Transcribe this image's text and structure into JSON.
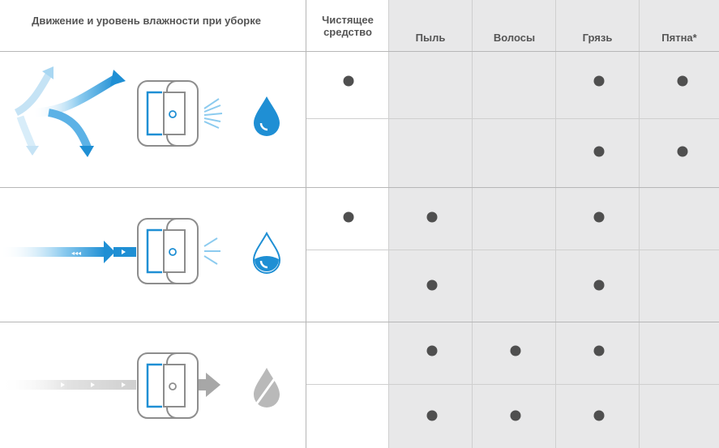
{
  "header": {
    "mode_title": "Движение и уровень влажности при уборке",
    "columns": [
      "Чистящее средство",
      "Пыль",
      "Волосы",
      "Грязь",
      "Пятна*"
    ]
  },
  "rows": [
    {
      "mode": "wet-cleaning",
      "moisture": "high",
      "options": [
        {
          "cells": [
            true,
            false,
            false,
            true,
            true
          ]
        },
        {
          "cells": [
            false,
            false,
            false,
            true,
            true
          ]
        }
      ]
    },
    {
      "mode": "damp-sweeping",
      "moisture": "medium",
      "options": [
        {
          "cells": [
            true,
            true,
            false,
            true,
            false
          ]
        },
        {
          "cells": [
            false,
            true,
            false,
            true,
            false
          ]
        }
      ]
    },
    {
      "mode": "dry-sweeping",
      "moisture": "none",
      "options": [
        {
          "cells": [
            false,
            true,
            true,
            true,
            false
          ]
        },
        {
          "cells": [
            false,
            true,
            true,
            true,
            false
          ]
        }
      ]
    }
  ],
  "colors": {
    "accent_blue": "#1f8fd4",
    "light_blue": "#a9d7f2",
    "grey_icon": "#b9b9b9",
    "cell_shade": "#e8e8e9",
    "dot": "#4f4f4f"
  }
}
